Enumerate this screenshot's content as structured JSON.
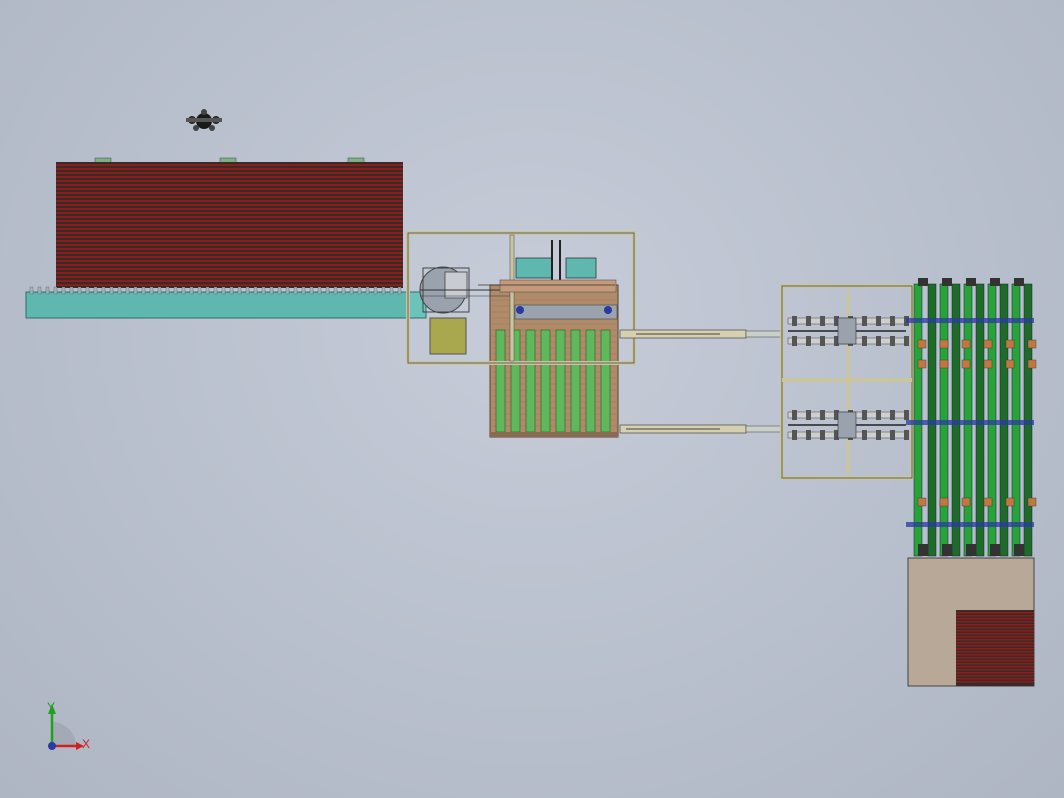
{
  "viewport": {
    "background": "#bcc3cf",
    "triad": {
      "x_label": "X",
      "y_label": "Y"
    }
  },
  "colors": {
    "stack_red": "#8a1f1a",
    "stack_dark": "#3a2a2a",
    "conveyor_cyan": "#5fb8b0",
    "frame_olive": "#c9c5a0",
    "motor_yellow": "#a9a84e",
    "rail_green": "#5fb85c",
    "column_green": "#28a33a",
    "wood_brown": "#b08b6a",
    "base_tan": "#b8a898",
    "accent_blue": "#2a3aa0",
    "accent_orange": "#c07840"
  },
  "scene": {
    "components": [
      "red-sheet-stack",
      "infeed-conveyor",
      "robot-gripper",
      "press-frame",
      "rail-bed",
      "transfer-shafts",
      "cart-frame",
      "vertical-column-rack",
      "outfeed-stack"
    ]
  }
}
